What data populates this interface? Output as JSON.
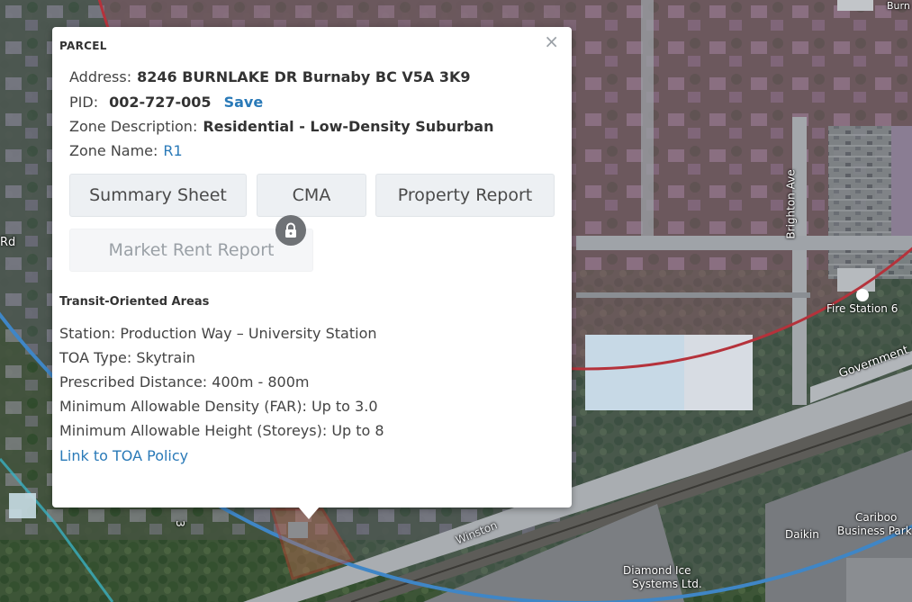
{
  "map": {
    "road_labels": {
      "brighton_ave": "Brighton Ave",
      "government": "Government",
      "winston": "Winston",
      "rd_fragment": "Rd",
      "street_fragment": "3"
    },
    "place_labels": {
      "fire_station": "Fire Station 6",
      "daikin": "Daikin",
      "cariboo": "Cariboo",
      "business_park": "Business Park",
      "diamond_ice": "Diamond Ice",
      "systems_ltd": "Systems Ltd.",
      "burnaby_fragment": "Burn"
    },
    "colors": {
      "toa_inner_outline": "#b5323b",
      "toa_outer_outline": "#3f86c6",
      "selected_parcel": "#c0392b"
    }
  },
  "popup": {
    "heading": "PARCEL",
    "close_icon": "×",
    "fields": {
      "address_label": "Address:",
      "address_value": "8246 BURNLAKE DR Burnaby BC V5A 3K9",
      "pid_label": "PID:",
      "pid_value": "002-727-005",
      "save_link": "Save",
      "zone_desc_label": "Zone Description:",
      "zone_desc_value": "Residential - Low-Density Suburban",
      "zone_name_label": "Zone Name:",
      "zone_name_value": "R1"
    },
    "buttons": {
      "summary_sheet": "Summary Sheet",
      "cma": "CMA",
      "property_report": "Property Report",
      "market_rent_report": "Market Rent Report"
    },
    "toa": {
      "title": "Transit-Oriented Areas",
      "station": "Station: Production Way – University Station",
      "type": "TOA Type: Skytrain",
      "distance": "Prescribed Distance: 400m - 800m",
      "density": "Minimum Allowable Density (FAR): Up to 3.0",
      "height": "Minimum Allowable Height (Storeys): Up to 8",
      "policy_link": "Link to TOA Policy"
    },
    "colors": {
      "link": "#2a7ab8",
      "lock_badge": "#6f7276"
    }
  }
}
